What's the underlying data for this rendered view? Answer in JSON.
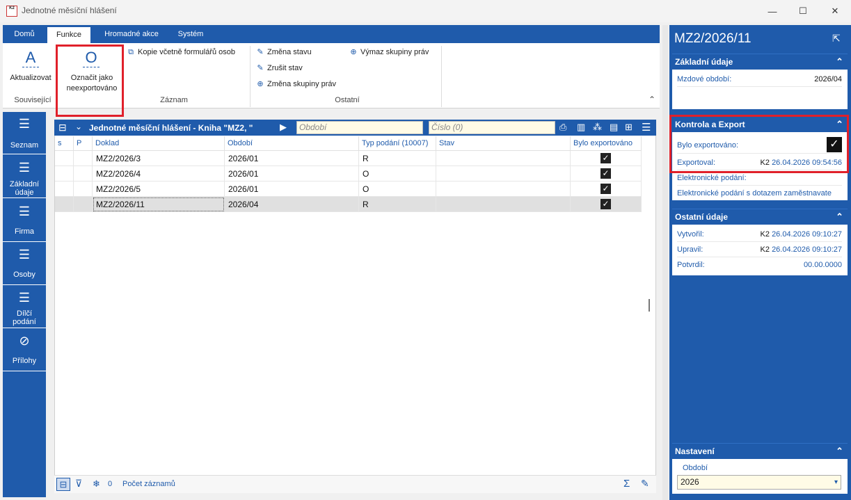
{
  "window": {
    "title": "Jednotné měsíční hlášení",
    "minimize": "—",
    "maximize": "☐",
    "close": "✕",
    "logo_text": "K2"
  },
  "ribbon": {
    "tabs": [
      "Domů",
      "Funkce",
      "Hromadné akce",
      "Systém"
    ],
    "active_tab": "Funkce",
    "groups": {
      "souvisejici": {
        "label": "Související",
        "refresh_label": "Aktualizovat"
      },
      "zaznam": {
        "label": "Záznam",
        "mark_label_1": "Označit jako",
        "mark_label_2": "neexportováno",
        "copy_label": "Kopie včetně formulářů osob"
      },
      "ostatni": {
        "label": "Ostatní",
        "change_state": "Změna stavu",
        "cancel_state": "Zrušit stav",
        "change_group": "Změna skupiny práv",
        "delete_group": "Výmaz skupiny práv"
      }
    },
    "collapse": "⌃"
  },
  "leftnav": {
    "items": [
      {
        "label": "Seznam",
        "icon": "list-icon"
      },
      {
        "label": "Základní",
        "label2": "údaje",
        "icon": "list-icon"
      },
      {
        "label": "Firma",
        "icon": "list-icon"
      },
      {
        "label": "Osoby",
        "icon": "list-icon"
      },
      {
        "label": "Dílčí",
        "label2": "podání",
        "icon": "list-icon"
      },
      {
        "label": "Přílohy",
        "icon": "paperclip-icon"
      }
    ]
  },
  "grid": {
    "title": "Jednotné měsíční hlášení - Kniha \"MZ2, \"",
    "period_placeholder": "Období",
    "number_placeholder": "Číslo (0)",
    "columns": [
      "s",
      "P",
      "Doklad",
      "Období",
      "Typ podání (10007)",
      "Stav",
      "Bylo exportováno"
    ],
    "rows": [
      {
        "doklad": "MZ2/2026/3",
        "obdobi": "2026/01",
        "typ": "R",
        "stav": "",
        "exported": true
      },
      {
        "doklad": "MZ2/2026/4",
        "obdobi": "2026/01",
        "typ": "O",
        "stav": "",
        "exported": true
      },
      {
        "doklad": "MZ2/2026/5",
        "obdobi": "2026/01",
        "typ": "O",
        "stav": "",
        "exported": true
      },
      {
        "doklad": "MZ2/2026/11",
        "obdobi": "2026/04",
        "typ": "R",
        "stav": "",
        "exported": true
      }
    ],
    "footer": {
      "filter_count": "0",
      "record_count_label": "Počet záznamů",
      "sum_symbol": "Σ"
    }
  },
  "rightpanel": {
    "title": "MZ2/2026/11",
    "zakladni": {
      "header": "Základní údaje",
      "period_label": "Mzdové období:",
      "period_value": "2026/04"
    },
    "kontrola": {
      "header": "Kontrola a Export",
      "exported_label": "Bylo exportováno:",
      "exported_by_label": "Exportoval:",
      "exported_by_user": "K2",
      "exported_by_date": "26.04.2026 09:54:56",
      "epodani_label": "Elektronické podání:",
      "epodani_query_label": "Elektronické podání s dotazem zaměstnavate"
    },
    "ostatni": {
      "header": "Ostatní údaje",
      "created_label": "Vytvořil:",
      "created_user": "K2",
      "created_date": "26.04.2026 09:10:27",
      "updated_label": "Upravil:",
      "updated_user": "K2",
      "updated_date": "26.04.2026 09:10:27",
      "confirmed_label": "Potvrdil:",
      "confirmed_date": "00.00.0000"
    },
    "nastaveni": {
      "header": "Nastavení",
      "period_label": "Období",
      "period_value": "2026"
    }
  },
  "colors": {
    "accent": "#1f5bab",
    "highlight": "#e0202a",
    "input_bg": "#fffbe6"
  }
}
